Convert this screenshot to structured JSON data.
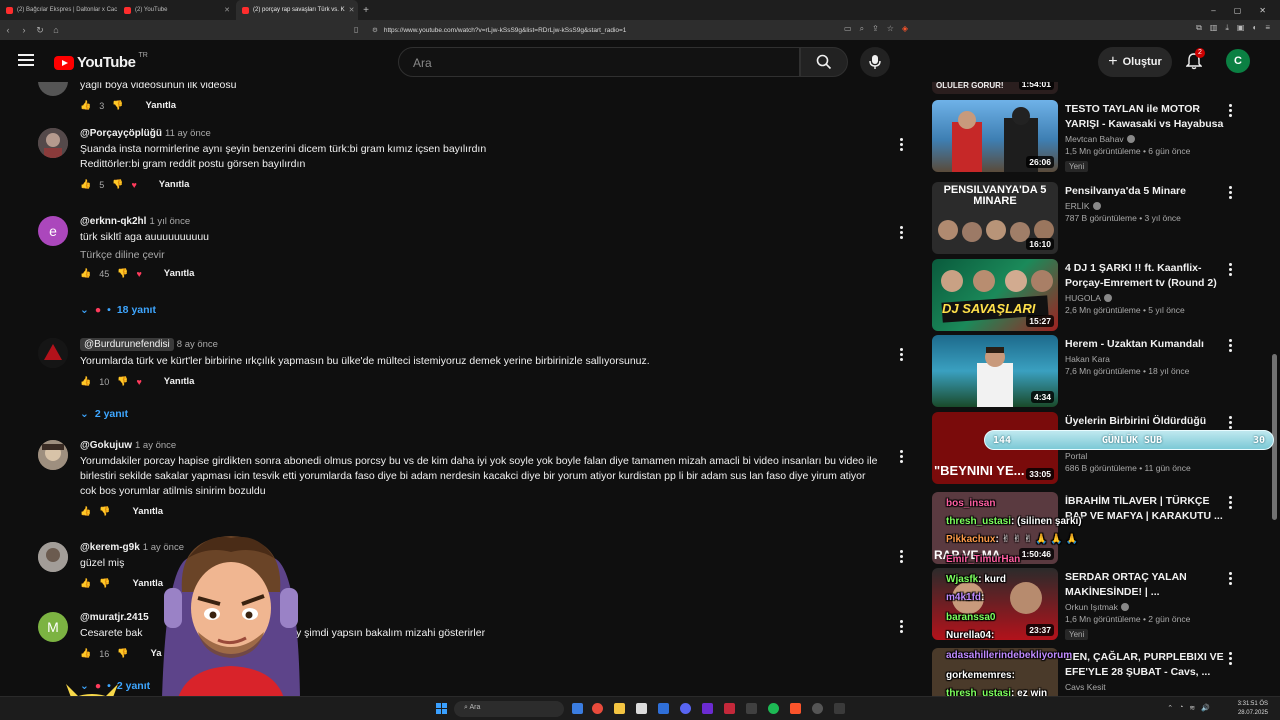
{
  "browser": {
    "tabs": [
      {
        "label": "(2) Bağcılar Ekspres | Daltonlar x Cac"
      },
      {
        "label": "(2) YouTube"
      },
      {
        "label": "(2) porçay rap savaşları Türk vs. K"
      }
    ],
    "url": "https://www.youtube.com/watch?v=rLjw-kSsS9g&list=RDrLjw-kSsS9g&start_radio=1"
  },
  "header": {
    "logo_text": "YouTube",
    "country": "TR",
    "search_placeholder": "Ara",
    "create_label": "Oluştur",
    "notif_count": "2",
    "avatar_letter": "C"
  },
  "comments": {
    "top_partial": {
      "text": "yağlı boya videosunun ilk videosu",
      "likes": "3",
      "reply": "Yanıtla"
    },
    "items": [
      {
        "handle": "@Porçayçöplüğü",
        "date": "11 ay önce",
        "text": "Şuanda insta normirlerine aynı şeyin benzerini dicem türk:bi gram kımız içsen bayılırdın",
        "text2": "Redittörler:bi gram reddit postu görsen bayılırdın",
        "likes": "5",
        "reply": "Yanıtla"
      },
      {
        "handle": "@erknn-qk2hl",
        "date": "1 yıl önce",
        "text": "türk sikltî aga auuuuuuuuuu",
        "translate": "Türkçe diline çevir",
        "likes": "45",
        "reply": "Yanıtla",
        "replies": "18 yanıt"
      },
      {
        "handle": "@Burdurunefendisi",
        "date": "8 ay önce",
        "text": "Yorumlarda türk ve kürt'ler birbirine ırkçılık yapmasın bu ülke'de mülteci istemiyoruz demek yerine birbirinizle sallıyorsunuz.",
        "likes": "10",
        "reply": "Yanıtla",
        "replies": "2 yanıt"
      },
      {
        "handle": "@Gokujuw",
        "date": "1 ay önce",
        "text": "Yorumdakiler porcay hapise girdikten sonra abonedi olmus porcsy bu vs de kim daha iyi yok soyle yok boyle falan diye tamamen mizah amacli bi video insanları bu video ile",
        "text2": "birlestiri sekilde sakalar yapması icin tesvik etti yorumlarda faso diye bi adam nerdesin kacakci diye bir yorum atiyor kurdistan pp li bir adam sus lan faso diye yirum atiyor",
        "text3": "cok bos yorumlar atilmis sinirim bozuldu",
        "likes": "",
        "reply": "Yanıtla"
      },
      {
        "handle": "@kerem-g9k",
        "date": "1 ay önce",
        "text": "güzel miş",
        "likes": "",
        "reply": "Yanıtla"
      },
      {
        "handle": "@muratjr.2415",
        "date": "",
        "text": "Cesarete bak",
        "text_right": "y şimdi yapsın bakalım mizahi gösterirler",
        "likes": "16",
        "reply": "Ya",
        "replies": "2 yanıt"
      }
    ]
  },
  "sidebar": {
    "top_partial_duration": "1:54:01",
    "top_partial_label": "ÖLÜLER GÖRÜR!",
    "videos": [
      {
        "title": "TESTO TAYLAN ile MOTOR YARIŞI - Kawasaki vs Hayabusa",
        "channel": "Mevtcan Bahav",
        "stats": "1,5 Mn görüntüleme • 6 gün önce",
        "badge": "Yeni",
        "duration": "26:06"
      },
      {
        "title": "Pensilvanya'da 5 Minare",
        "channel": "ERLİK",
        "stats": "787 B görüntüleme • 3 yıl önce",
        "duration": "16:10",
        "thumb_text": "PENSILVANYA'DA 5 MINARE"
      },
      {
        "title": "4 DJ 1 ŞARKI !! ft. Kaanflix-Porçay-Emremert tv (Round 2)",
        "channel": "HUGOLA",
        "stats": "2,6 Mn görüntüleme • 5 yıl önce",
        "duration": "15:27",
        "thumb_text": "DJ SAVAŞLARI"
      },
      {
        "title": "Herem - Uzaktan Kumandalı",
        "channel": "Hakan Kara",
        "stats": "7,6 Mn görüntüleme • 18 yıl önce",
        "duration": "4:34"
      },
      {
        "title": "Üyelerin Birbirini Öldürdüğü",
        "channel": "Portal",
        "stats": "686 B görüntüleme • 11 gün önce",
        "duration": "33:05",
        "thumb_text": "\"BEYNINI YE..."
      },
      {
        "title": "İBRAHİM TİLAVER | TÜRKÇE RAP VE MAFYA | KARAKUTU ...",
        "channel": "",
        "stats": "",
        "duration": "1:50:46",
        "thumb_text": "RAP VE MA"
      },
      {
        "title": "SERDAR ORTAÇ YALAN MAKİNESİNDE! | ...",
        "channel": "Orkun Işıtmak",
        "stats": "1,6 Mn görüntüleme • 2 gün önce",
        "badge": "Yeni",
        "duration": "23:37"
      },
      {
        "title": "BEN, ÇAĞLAR, PURPLEBIXI VE EFE'YLE 28 ŞUBAT - Cavs, ...",
        "channel": "Cavs Kesit",
        "stats": "",
        "duration": ""
      }
    ]
  },
  "overlay": {
    "sub_count": "144",
    "sub_label": "GÜNLÜK SUB",
    "sub_goal": "30",
    "chat": [
      {
        "user": "bos_insan",
        "msg": "",
        "cls": "u"
      },
      {
        "user": "thresh_ustasi",
        "msg": ": (silinen şarkı)",
        "cls": "u g"
      },
      {
        "user": "Pikkachux",
        "msg": ": ✌ ✌ ✌ 🙏 🙏 🙏",
        "cls": "u o"
      },
      {
        "user": "Emir_TimurHan",
        "msg": "",
        "cls": "u"
      },
      {
        "user": "Wjasfk",
        "msg": ": kurd",
        "cls": "u g"
      },
      {
        "user": "m4k1fd",
        "msg": ":",
        "cls": "u p"
      },
      {
        "user": "baranssa0",
        "msg": "",
        "cls": "u g"
      },
      {
        "user": "Nurella04",
        "msg": ":",
        "cls": "m"
      },
      {
        "user": "adasahillerindebekliyorum",
        "msg": "",
        "cls": "u p"
      },
      {
        "user": "gorkememres",
        "msg": ":",
        "cls": "m"
      },
      {
        "user": "thresh_ustasi",
        "msg": ": ez win",
        "cls": "u g"
      }
    ]
  },
  "taskbar": {
    "search": "Ara",
    "time": "3:31:51 ÖS",
    "date": "28.07.2025"
  }
}
